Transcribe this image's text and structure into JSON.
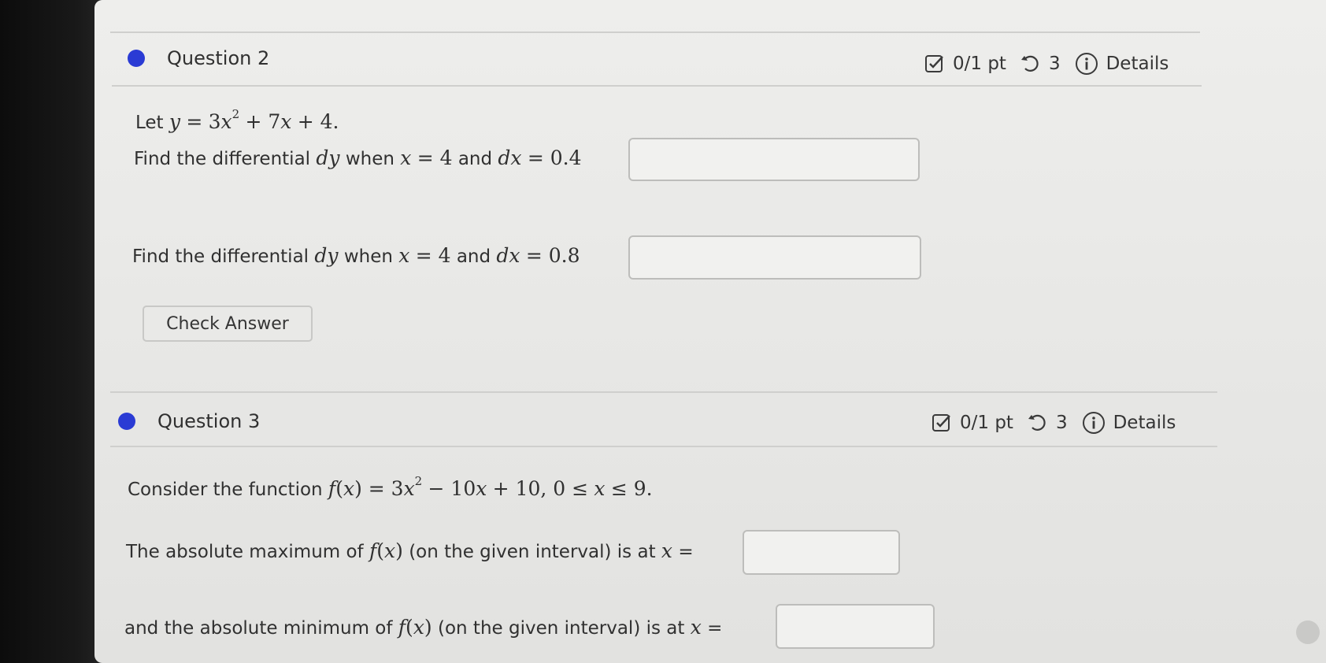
{
  "questions": [
    {
      "title": "Question 2",
      "score": "0/1 pt",
      "attempts": "3",
      "details_label": "Details",
      "intro": {
        "prefix": "Let",
        "lhs": "y",
        "rhs_a": "3",
        "var": "x",
        "exp": "2",
        "rhs_b": "+ 7",
        "var2": "x",
        "rhs_c": "+ 4."
      },
      "parts": [
        {
          "text": "Find the differential",
          "dy": "dy",
          "when": "when",
          "x": "x",
          "eq1": "= 4",
          "and": "and",
          "dx": "dx",
          "eq2": "= 0.4",
          "value": ""
        },
        {
          "text": "Find the differential",
          "dy": "dy",
          "when": "when",
          "x": "x",
          "eq1": "= 4",
          "and": "and",
          "dx": "dx",
          "eq2": "= 0.8",
          "value": ""
        }
      ],
      "check_label": "Check Answer"
    },
    {
      "title": "Question 3",
      "score": "0/1 pt",
      "attempts": "3",
      "details_label": "Details",
      "intro": {
        "prefix": "Consider the function",
        "f": "f",
        "x": "x",
        "eq": ") = 3",
        "var": "x",
        "exp": "2",
        "rest": "− 10",
        "var2": "x",
        "rest2": "+ 10,  0 ≤",
        "var3": "x",
        "rest3": "≤ 9."
      },
      "parts": [
        {
          "text": "The absolute maximum of",
          "f": "f",
          "x": "x",
          "tail": "(on the given interval) is at",
          "xv": "x",
          "eq": "=",
          "value": ""
        },
        {
          "text": "and the absolute minimum of",
          "f": "f",
          "x": "x",
          "tail": "(on the given interval) is at",
          "xv": "x",
          "eq": "=",
          "value": ""
        }
      ]
    }
  ],
  "colors": {
    "bullet": "#2a3bd4",
    "background": "#e9e9e7"
  },
  "icons": [
    "checkbox-score-icon",
    "retry-icon",
    "info-icon"
  ]
}
